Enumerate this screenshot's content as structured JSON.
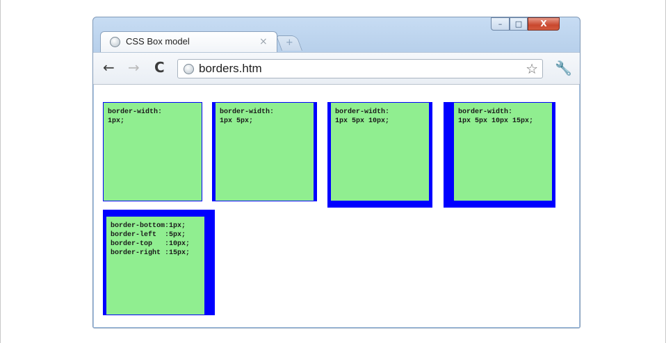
{
  "window": {
    "tab_title": "CSS Box model",
    "tab_close": "×",
    "new_tab": "+",
    "controls": {
      "minimize": "–",
      "maximize": "□",
      "close": "X"
    }
  },
  "toolbar": {
    "back": "←",
    "forward": "→",
    "reload": "C",
    "url": "borders.htm",
    "bookmark": "☆",
    "wrench": "🔧"
  },
  "colors": {
    "box_fill": "#90ee90",
    "border": "#0000ff"
  },
  "boxes": [
    {
      "text": "border-width:\n1px;"
    },
    {
      "text": "border-width:\n1px 5px;"
    },
    {
      "text": "border-width:\n1px 5px 10px;"
    },
    {
      "text": "border-width:\n1px 5px 10px 15px;"
    },
    {
      "text": "border-bottom:1px;\nborder-left  :5px;\nborder-top   :10px;\nborder-right :15px;"
    }
  ]
}
